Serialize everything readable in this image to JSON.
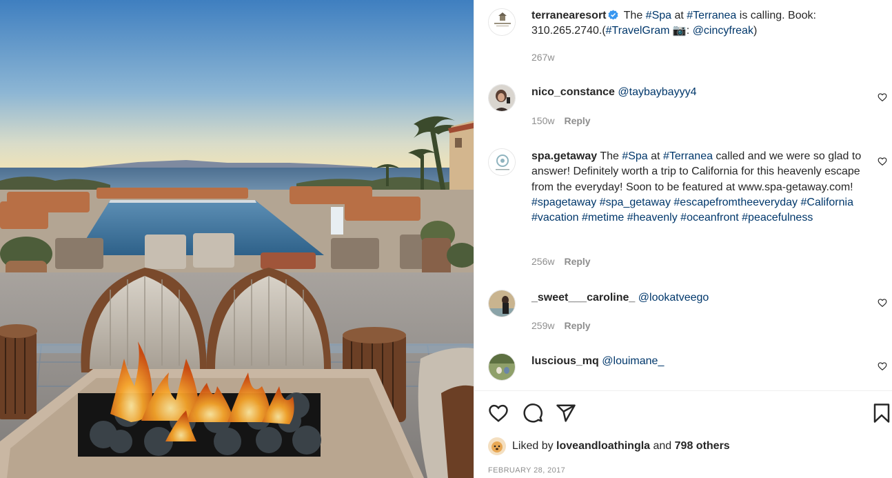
{
  "post": {
    "author": "terranearesort",
    "caption_pre": " The ",
    "caption_tag1": "#Spa",
    "caption_mid": " at ",
    "caption_tag2": "#Terranea",
    "caption_rest": " is calling. Book: 310.265.2740.(",
    "caption_tag3": "#TravelGram",
    "caption_camera": " 📷: ",
    "caption_mention": "@cincyfreak",
    "caption_close": ")",
    "time": "267w"
  },
  "comments": [
    {
      "username": "nico_constance",
      "parts": [
        {
          "t": " ",
          "link": false
        },
        {
          "t": "@taybaybayyy4",
          "link": true
        }
      ],
      "time": "150w",
      "reply": "Reply"
    },
    {
      "username": "spa.getaway",
      "parts": [
        {
          "t": " The ",
          "link": false
        },
        {
          "t": "#Spa",
          "link": true
        },
        {
          "t": " at ",
          "link": false
        },
        {
          "t": "#Terranea",
          "link": true
        },
        {
          "t": " called and we were so glad to answer! Definitely worth a trip to California for this heavenly escape from the everyday! Soon to be featured at www.spa-getaway.com! ",
          "link": false
        },
        {
          "t": "#spagetaway",
          "link": true
        },
        {
          "t": " ",
          "link": false
        },
        {
          "t": "#spa_getaway",
          "link": true
        },
        {
          "t": " ",
          "link": false
        },
        {
          "t": "#escapefromtheeveryday",
          "link": true
        },
        {
          "t": " ",
          "link": false
        },
        {
          "t": "#California",
          "link": true
        },
        {
          "t": " ",
          "link": false
        },
        {
          "t": "#vacation",
          "link": true
        },
        {
          "t": " ",
          "link": false
        },
        {
          "t": "#metime",
          "link": true
        },
        {
          "t": " ",
          "link": false
        },
        {
          "t": "#heavenly",
          "link": true
        },
        {
          "t": " ",
          "link": false
        },
        {
          "t": "#oceanfront",
          "link": true
        },
        {
          "t": " ",
          "link": false
        },
        {
          "t": "#peacefulness",
          "link": true
        }
      ],
      "time": "256w",
      "reply": "Reply"
    },
    {
      "username": "_sweet___caroline_",
      "parts": [
        {
          "t": " ",
          "link": false
        },
        {
          "t": "@lookatveego",
          "link": true
        }
      ],
      "time": "259w",
      "reply": "Reply"
    },
    {
      "username": "luscious_mq",
      "parts": [
        {
          "t": " ",
          "link": false
        },
        {
          "t": "@louimane_",
          "link": true
        }
      ],
      "time": "",
      "reply": ""
    }
  ],
  "likes": {
    "prefix": "Liked by ",
    "user": "loveandloathingla",
    "and": " and ",
    "others": "798 others"
  },
  "date": "FEBRUARY 28, 2017",
  "icons": {
    "like": "heart-icon",
    "comment": "comment-icon",
    "share": "paper-plane-icon",
    "save": "bookmark-icon",
    "verified": "verified-badge-icon",
    "comment_like": "small-heart-icon"
  },
  "colors": {
    "link": "#00376b",
    "muted": "#8e8e8e",
    "verified": "#3897f0",
    "text": "#262626"
  }
}
